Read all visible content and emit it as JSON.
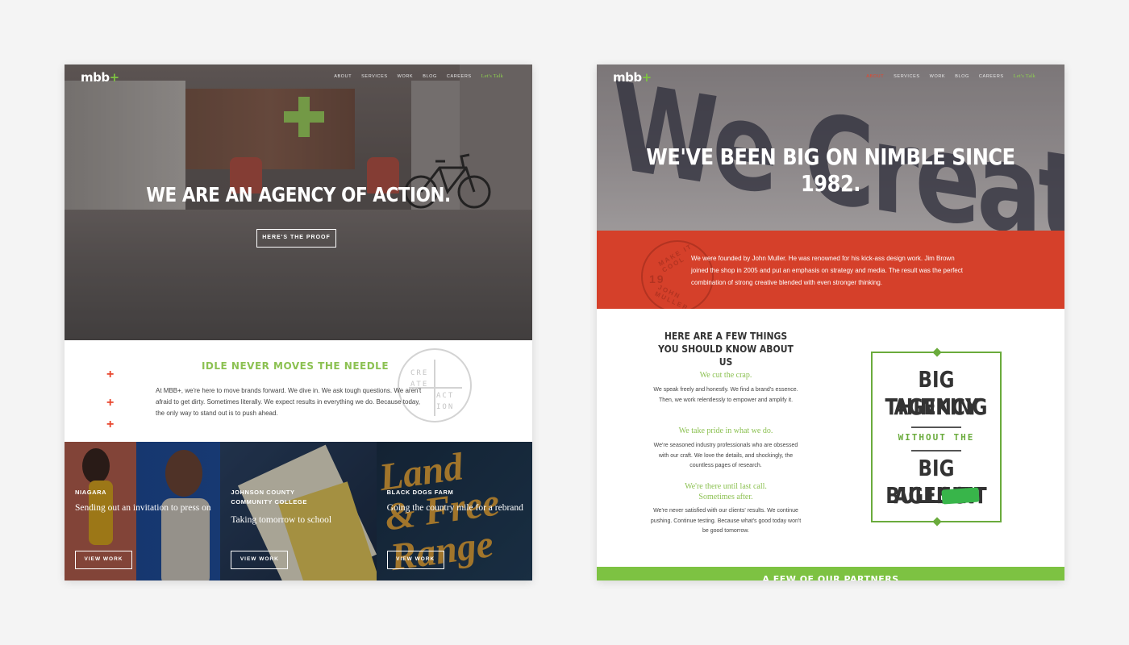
{
  "nav": {
    "logo": "mbb",
    "logo_plus": "+",
    "links": [
      "ABOUT",
      "SERVICES",
      "WORK",
      "BLOG",
      "CAREERS"
    ],
    "cta": "Let's Talk"
  },
  "home": {
    "hero_title": "WE ARE AN AGENCY OF ACTION.",
    "hero_button": "HERE'S THE PROOF",
    "idle_title": "IDLE NEVER MOVES THE NEEDLE",
    "idle_body": "At MBB+, we're here to move brands forward. We dive in. We ask tough questions. We aren't afraid to get dirty. Sometimes literally. We expect results in everything we do. Because today, the only way to stand out is to push ahead.",
    "stamp_lines": [
      "CRE",
      "ATE",
      "ACT",
      "ION"
    ],
    "cards": [
      {
        "client": "NIAGARA",
        "desc": "Sending out an invitation to press on",
        "button": "VIEW WORK"
      },
      {
        "client": "JOHNSON COUNTY COMMUNITY COLLEGE",
        "desc": "Taking tomorrow to school",
        "button": "VIEW WORK"
      },
      {
        "client": "BLACK DOGS FARM",
        "desc": "Going the country mile for a rebrand",
        "button": "VIEW WORK"
      }
    ]
  },
  "about": {
    "hero_title": "WE'VE BEEN BIG ON NIMBLE SINCE 1982.",
    "hero_backdrop": "We Create Action",
    "intro": "We were founded by John Muller. He was renowned for his kick-ass design work. Jim Brown joined the shop in 2005 and put an emphasis on strategy and media. The result was the perfect combination of strong creative blended with even stronger thinking.",
    "seal": {
      "top": "MAKE IT COOL",
      "bottom": "JOHN MULLER",
      "year": "19"
    },
    "things_title": "HERE ARE A FEW THINGS YOU SHOULD KNOW ABOUT US",
    "things": [
      {
        "title": "We cut the crap.",
        "body": "We speak freely and honestly. We find a brand's essence. Then, we work relentlessly to empower and amplify it."
      },
      {
        "title": "We take pride in what we do.",
        "body": "We're seasoned industry professionals who are obsessed with our craft. We love the details, and shockingly, the countless pages of research."
      },
      {
        "title": "We're there until last call. Sometimes after.",
        "body": "We're never satisfied with our clients' results. We continue pushing. Continue testing. Because what's good today won't be good tomorrow."
      }
    ],
    "poster": {
      "line1": "BIG AGENCY",
      "line2": "THINKING",
      "mid": "WITHOUT THE",
      "line3": "BIG AGENCY",
      "line4": "BULLSHIT"
    },
    "partners": "A FEW OF OUR PARTNERS"
  },
  "colors": {
    "green": "#8cc152",
    "red": "#e8442b",
    "orange": "#d5402a"
  }
}
